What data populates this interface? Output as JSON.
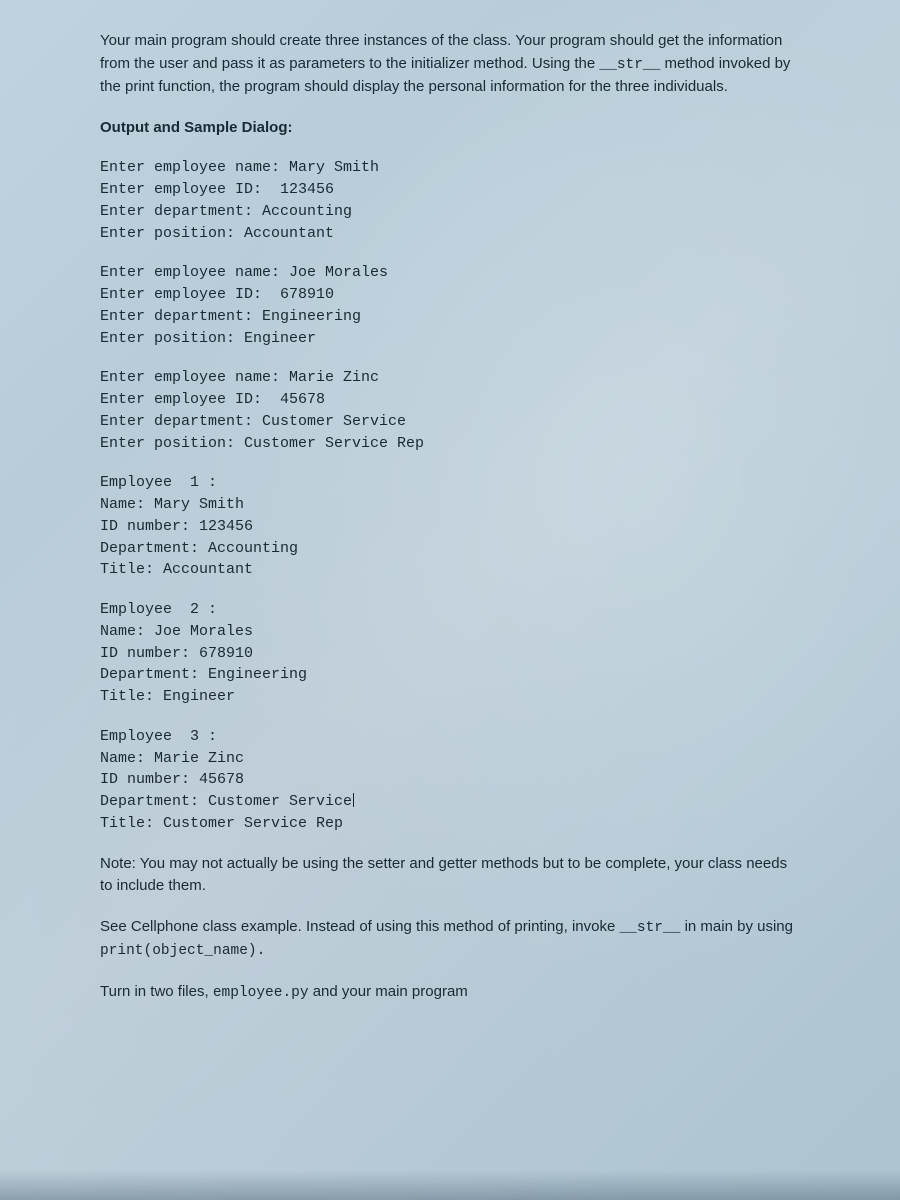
{
  "intro": {
    "p1a": "Your main program should create three instances of the class.  Your program should get the information from the user and pass it as parameters to the initializer method.   Using the ",
    "p1_code": "__str__",
    "p1b": " method invoked by the print function, the program should display the personal information for the three individuals."
  },
  "heading": "Output and Sample Dialog:",
  "dialog": {
    "e1": "Enter employee name: Mary Smith\nEnter employee ID:  123456\nEnter department: Accounting\nEnter position: Accountant",
    "e2": "Enter employee name: Joe Morales\nEnter employee ID:  678910\nEnter department: Engineering\nEnter position: Engineer",
    "e3": "Enter employee name: Marie Zinc\nEnter employee ID:  45678\nEnter department: Customer Service\nEnter position: Customer Service Rep",
    "o1": "Employee  1 :\nName: Mary Smith\nID number: 123456\nDepartment: Accounting\nTitle: Accountant",
    "o2": "Employee  2 :\nName: Joe Morales\nID number: 678910\nDepartment: Engineering\nTitle: Engineer",
    "o3a": "Employee  3 :\nName: Marie Zinc\nID number: 45678\nDepartment: Customer Service",
    "o3b": "Title: Customer Service Rep"
  },
  "note": "Note:  You may not actually be using the setter and getter methods but to be complete, your class needs to include them.",
  "see": {
    "a": "See Cellphone class example.  Instead of using this method of printing, invoke ",
    "code1": "__str__",
    "b": " in main by using ",
    "code2": "print(object_name).",
    "c": ""
  },
  "turnin": {
    "a": "Turn in two files, ",
    "code": "employee.py",
    "b": " and your main program"
  }
}
